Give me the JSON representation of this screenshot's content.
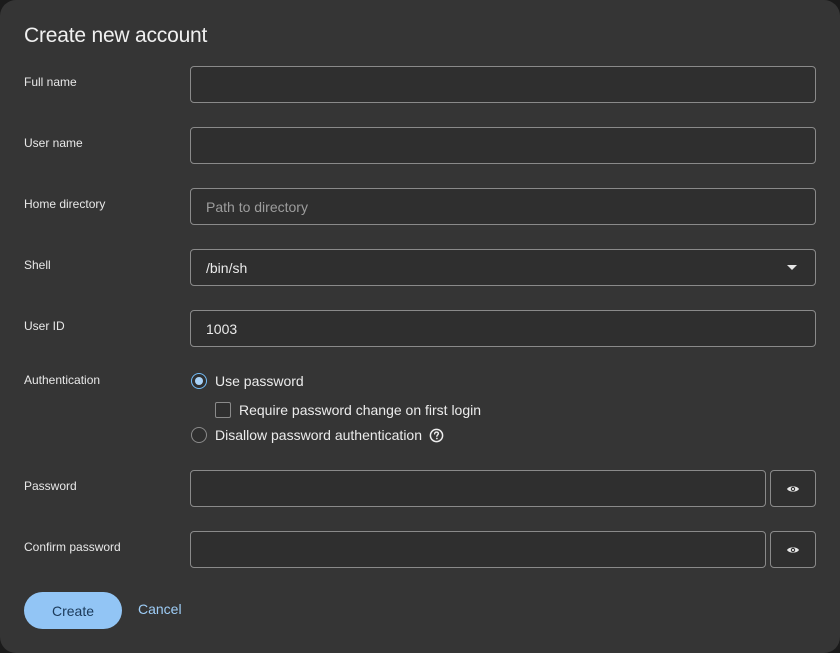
{
  "dialog": {
    "title": "Create new account"
  },
  "fields": {
    "full_name": {
      "label": "Full name",
      "value": ""
    },
    "user_name": {
      "label": "User name",
      "value": ""
    },
    "home_directory": {
      "label": "Home directory",
      "placeholder": "Path to directory",
      "value": ""
    },
    "shell": {
      "label": "Shell",
      "value": "/bin/sh"
    },
    "user_id": {
      "label": "User ID",
      "value": "1003"
    }
  },
  "authentication": {
    "label": "Authentication",
    "use_password": {
      "label": "Use password",
      "checked": true
    },
    "require_change": {
      "label": "Require password change on first login",
      "checked": false
    },
    "disallow": {
      "label": "Disallow password authentication",
      "checked": false
    }
  },
  "password": {
    "label": "Password",
    "value": ""
  },
  "confirm_password": {
    "label": "Confirm password",
    "value": ""
  },
  "actions": {
    "create_label": "Create",
    "cancel_label": "Cancel"
  },
  "colors": {
    "dialog_bg": "#353535",
    "accent": "#92c5f5",
    "link": "#9ecdf7"
  },
  "icons": {
    "select_caret": "caret-down-icon",
    "reveal_password": "eye-icon",
    "help": "question-circle-icon"
  }
}
